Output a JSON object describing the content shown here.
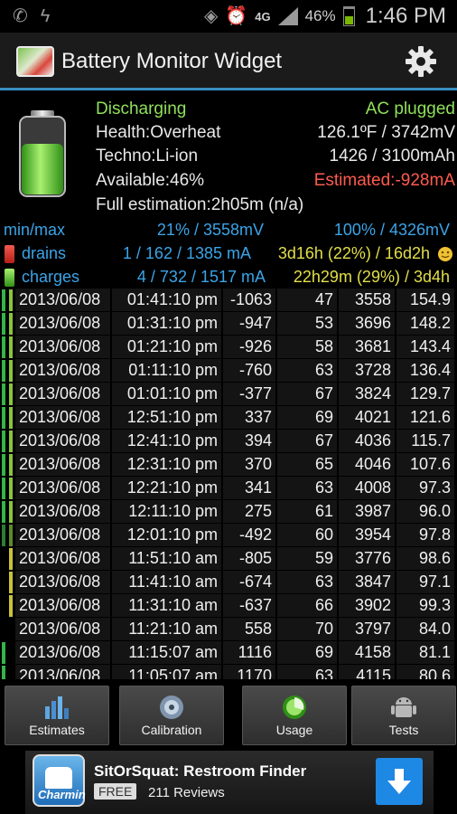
{
  "status_bar": {
    "battery_percent": "46%",
    "network": "4G",
    "time": "1:46 PM",
    "icons": [
      "missed-call-icon",
      "usb-icon",
      "nfc-icon",
      "alarm-icon",
      "signal-icon",
      "battery-icon"
    ]
  },
  "title_bar": {
    "title": "Battery Monitor Widget",
    "settings_icon": "gear-icon"
  },
  "summary": {
    "state": "Discharging",
    "power_source": "AC plugged",
    "health": "Health:Overheat",
    "temp_voltage": "126.1ºF / 3742mV",
    "techno": "Techno:Li-ion",
    "capacity": "1426 / 3100mAh",
    "available": "Available:46%",
    "estimated": "Estimated:-928mA",
    "full_estimation": "Full estimation:2h05m (n/a)",
    "battery_level": 0.46
  },
  "stats": {
    "minmax": {
      "label": "min/max",
      "min": "21% / 3558mV",
      "max": "100% / 4326mV"
    },
    "drains": {
      "label": "drains",
      "counts": "1 / 162 / 1385 mA",
      "time": "3d16h (22%) / 16d2h"
    },
    "charges": {
      "label": "charges",
      "counts": "4 / 732 / 1517 mA",
      "time": "22h29m (29%) / 3d4h"
    }
  },
  "log": [
    {
      "date": "2013/06/08",
      "time": "01:41:10 pm",
      "ma": "-1063",
      "pct": "47",
      "mv": "3558",
      "temp": "154.9",
      "b1": "#36b34a",
      "b2": "#8ac43a"
    },
    {
      "date": "2013/06/08",
      "time": "01:31:10 pm",
      "ma": "-947",
      "pct": "53",
      "mv": "3696",
      "temp": "148.2",
      "b1": "#36b34a",
      "b2": "#8ac43a"
    },
    {
      "date": "2013/06/08",
      "time": "01:21:10 pm",
      "ma": "-926",
      "pct": "58",
      "mv": "3681",
      "temp": "143.4",
      "b1": "#36b34a",
      "b2": "#8ac43a"
    },
    {
      "date": "2013/06/08",
      "time": "01:11:10 pm",
      "ma": "-760",
      "pct": "63",
      "mv": "3728",
      "temp": "136.4",
      "b1": "#36b34a",
      "b2": "#8ac43a"
    },
    {
      "date": "2013/06/08",
      "time": "01:01:10 pm",
      "ma": "-377",
      "pct": "67",
      "mv": "3824",
      "temp": "129.7",
      "b1": "#36b34a",
      "b2": "#8ac43a"
    },
    {
      "date": "2013/06/08",
      "time": "12:51:10 pm",
      "ma": "337",
      "pct": "69",
      "mv": "4021",
      "temp": "121.6",
      "b1": "#36b34a",
      "b2": "#8ac43a"
    },
    {
      "date": "2013/06/08",
      "time": "12:41:10 pm",
      "ma": "394",
      "pct": "67",
      "mv": "4036",
      "temp": "115.7",
      "b1": "#36b34a",
      "b2": "#8ac43a"
    },
    {
      "date": "2013/06/08",
      "time": "12:31:10 pm",
      "ma": "370",
      "pct": "65",
      "mv": "4046",
      "temp": "107.6",
      "b1": "#36b34a",
      "b2": "#8ac43a"
    },
    {
      "date": "2013/06/08",
      "time": "12:21:10 pm",
      "ma": "341",
      "pct": "63",
      "mv": "4008",
      "temp": "97.3",
      "b1": "#36b34a",
      "b2": "#8ac43a"
    },
    {
      "date": "2013/06/08",
      "time": "12:11:10 pm",
      "ma": "275",
      "pct": "61",
      "mv": "3987",
      "temp": "96.0",
      "b1": "#36b34a",
      "b2": "#8ac43a"
    },
    {
      "date": "2013/06/08",
      "time": "12:01:10 pm",
      "ma": "-492",
      "pct": "60",
      "mv": "3954",
      "temp": "97.8",
      "b1": "#2f7a34",
      "b2": "#5c8a2a"
    },
    {
      "date": "2013/06/08",
      "time": "11:51:10 am",
      "ma": "-805",
      "pct": "59",
      "mv": "3776",
      "temp": "98.6",
      "b1": "#000000",
      "b2": "#c9c23a"
    },
    {
      "date": "2013/06/08",
      "time": "11:41:10 am",
      "ma": "-674",
      "pct": "63",
      "mv": "3847",
      "temp": "97.1",
      "b1": "#000000",
      "b2": "#c9c23a"
    },
    {
      "date": "2013/06/08",
      "time": "11:31:10 am",
      "ma": "-637",
      "pct": "66",
      "mv": "3902",
      "temp": "99.3",
      "b1": "#000000",
      "b2": "#c9c23a"
    },
    {
      "date": "2013/06/08",
      "time": "11:21:10 am",
      "ma": "558",
      "pct": "70",
      "mv": "3797",
      "temp": "84.0",
      "b1": "#000000",
      "b2": "#000000"
    },
    {
      "date": "2013/06/08",
      "time": "11:15:07 am",
      "ma": "1116",
      "pct": "69",
      "mv": "4158",
      "temp": "81.1",
      "b1": "#36b34a",
      "b2": "#000000"
    },
    {
      "date": "2013/06/08",
      "time": "11:05:07 am",
      "ma": "1170",
      "pct": "63",
      "mv": "4115",
      "temp": "80.6",
      "b1": "#36b34a",
      "b2": "#000000"
    }
  ],
  "buttons": {
    "estimates": "Estimates",
    "calibration": "Calibration",
    "usage": "Usage",
    "tests": "Tests"
  },
  "ad": {
    "title": "SitOrSquat: Restroom Finder",
    "price": "FREE",
    "reviews": "211 Reviews",
    "icon_text": "Charmin"
  },
  "colors": {
    "accent": "#3a8fc0",
    "green": "#8fe05a",
    "red": "#ff5b4f",
    "blue": "#3ba4e8",
    "yellow": "#e3df4a"
  }
}
